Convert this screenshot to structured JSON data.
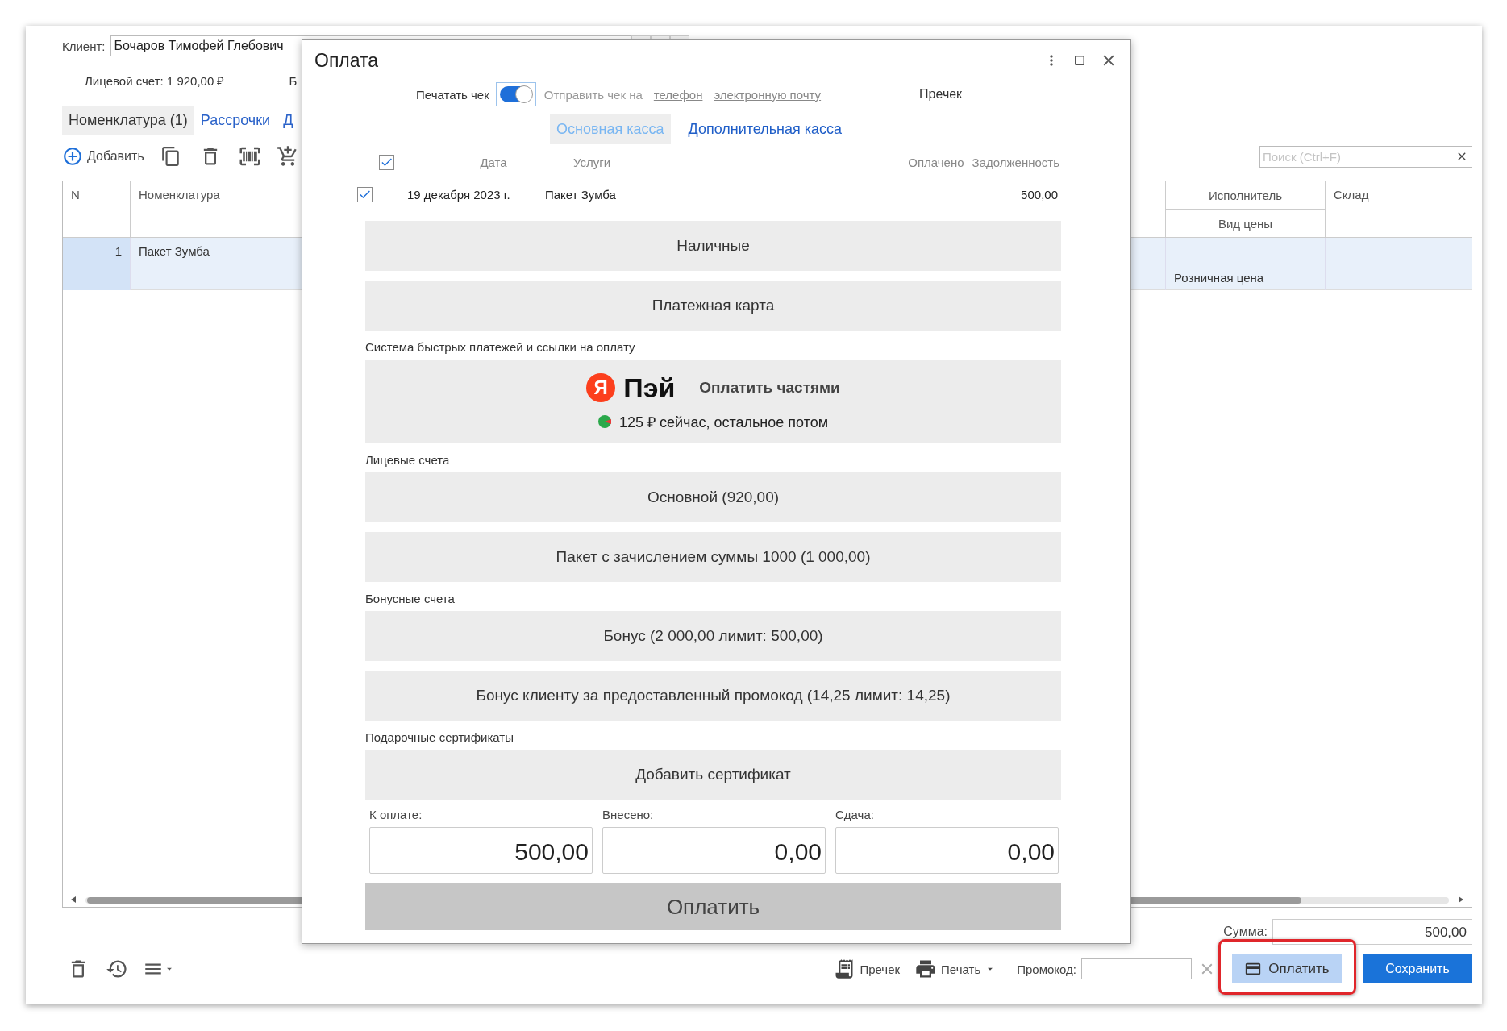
{
  "client_form": {
    "client_label": "Клиент:",
    "client_value": "Бочаров Тимофей Глебович",
    "account": "Лицевой счет: 1 920,00 ₽",
    "cut_text": "Б",
    "tabs": [
      {
        "label": "Номенклатура (1)",
        "selected": true
      },
      {
        "label": "Рассрочки",
        "selected": false
      },
      {
        "label": "Д",
        "selected": false
      }
    ],
    "add_label": "Добавить",
    "search": {
      "placeholder": "Поиск (Ctrl+F)"
    },
    "table": {
      "columns": [
        {
          "label": "N"
        },
        {
          "label": "Номенклатура"
        },
        {
          "label": "Исполнитель",
          "sub": "Вид цены"
        },
        {
          "label": "Склад"
        }
      ],
      "rows": [
        {
          "n": "1",
          "item": "Пакет Зумба",
          "price_type": "Розничная цена",
          "selected": true
        }
      ]
    },
    "total_label": "Сумма:",
    "total": "500,00",
    "footer": {
      "precheck": "Пречек",
      "print": "Печать",
      "promo_label": "Промокод:",
      "pay": "Оплатить",
      "save": "Сохранить",
      "pay_highlighted": true
    }
  },
  "payment_dialog": {
    "title": "Оплата",
    "print_receipt": {
      "label": "Печатать чек",
      "on": true
    },
    "send_label": "Отправить чек на",
    "send_links": [
      "телефон",
      "электронную почту"
    ],
    "precheck": "Пречек",
    "tabs": [
      {
        "label": "Основная касса",
        "selected": true
      },
      {
        "label": "Дополнительная касса",
        "selected": false
      }
    ],
    "services": {
      "all_checked": true,
      "columns": [
        "Дата",
        "Услуги",
        "Оплачено",
        "Задолженность"
      ],
      "rows": [
        {
          "checked": true,
          "date": "19 декабря 2023 г.",
          "service": "Пакет Зумба",
          "debt": "500,00"
        }
      ]
    },
    "options": [
      {
        "kind": "option",
        "label": "Наличные"
      },
      {
        "kind": "option",
        "label": "Платежная карта"
      },
      {
        "kind": "section",
        "label": "Система быстрых платежей и ссылки на оплату"
      },
      {
        "kind": "pay-later",
        "logo_letter": "Я",
        "logo_text": "Пэй",
        "label": "Оплатить частями",
        "note": "125 ₽ сейчас, остальное потом"
      },
      {
        "kind": "section",
        "label": "Лицевые счета"
      },
      {
        "kind": "option",
        "label": "Основной (920,00)"
      },
      {
        "kind": "option",
        "label": "Пакет с зачислением суммы 1000 (1 000,00)"
      },
      {
        "kind": "section",
        "label": "Бонусные счета"
      },
      {
        "kind": "option",
        "label": "Бонус (2 000,00 лимит: 500,00)"
      },
      {
        "kind": "option",
        "label": "Бонус клиенту за предоставленный промокод (14,25 лимит: 14,25)"
      },
      {
        "kind": "section",
        "label": "Подарочные сертификаты"
      },
      {
        "kind": "option",
        "label": "Добавить сертификат"
      }
    ],
    "amounts": [
      {
        "label": "К оплате:",
        "value": "500,00"
      },
      {
        "label": "Внесено:",
        "value": "0,00"
      },
      {
        "label": "Сдача:",
        "value": "0,00"
      }
    ],
    "pay_button": {
      "label": "Оплатить",
      "disabled": true
    }
  }
}
